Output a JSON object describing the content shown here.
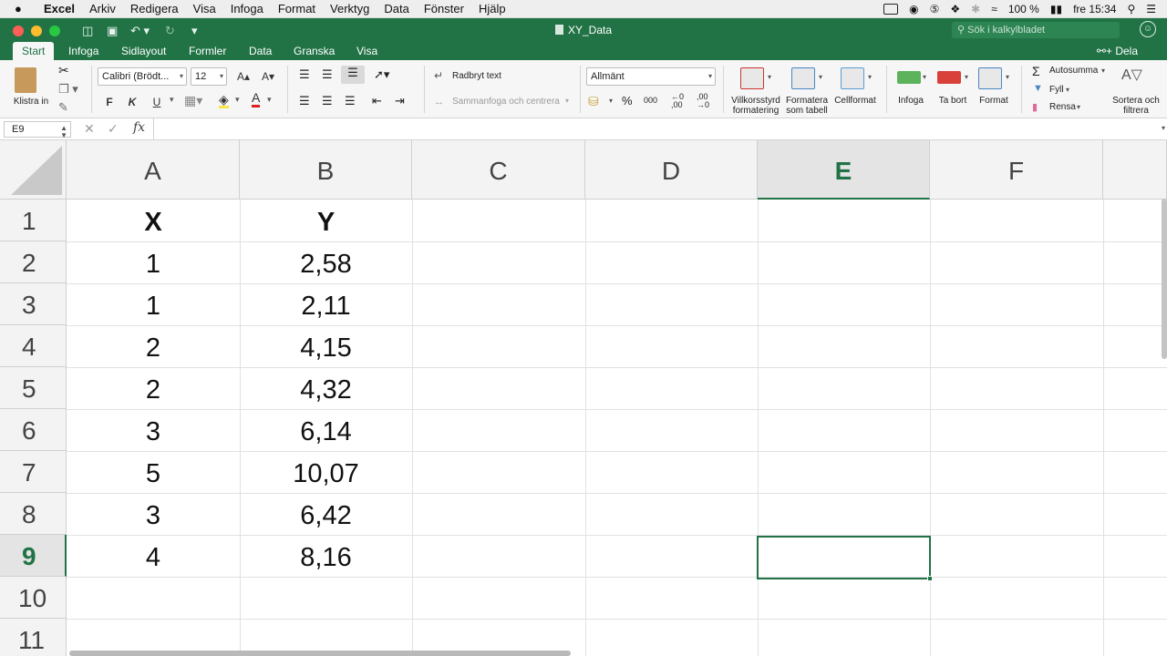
{
  "menubar": {
    "app_name": "Excel",
    "items": [
      "Arkiv",
      "Redigera",
      "Visa",
      "Infoga",
      "Format",
      "Verktyg",
      "Data",
      "Fönster",
      "Hjälp"
    ],
    "battery": "100 %",
    "clock": "fre 15:34"
  },
  "window": {
    "title": "XY_Data",
    "search_placeholder": "Sök i kalkylbladet",
    "share_label": "Dela"
  },
  "tabs": [
    "Start",
    "Infoga",
    "Sidlayout",
    "Formler",
    "Data",
    "Granska",
    "Visa"
  ],
  "active_tab": "Start",
  "ribbon": {
    "paste_label": "Klistra in",
    "font_name": "Calibri (Brödt...",
    "font_size": "12",
    "grow_font": "A▴",
    "shrink_font": "A▾",
    "bold": "F",
    "italic": "K",
    "underline": "U",
    "wrap_text": "Radbryt text",
    "merge_center": "Sammanfoga och centrera",
    "number_format": "Allmänt",
    "percent": "%",
    "thousands": "000",
    "conditional_formatting": "Villkorsstyrd formatering",
    "format_as_table": "Formatera som tabell",
    "cell_styles": "Cellformat",
    "insert": "Infoga",
    "delete": "Ta bort",
    "format": "Format",
    "autosum": "Autosumma",
    "fill": "Fyll",
    "clear": "Rensa",
    "sort_filter": "Sortera och filtrera"
  },
  "formula_bar": {
    "name_box": "E9",
    "cancel": "✕",
    "confirm": "✓",
    "fx": "fx",
    "content": ""
  },
  "sheet": {
    "columns": [
      "A",
      "B",
      "C",
      "D",
      "E",
      "F"
    ],
    "rows": [
      "1",
      "2",
      "3",
      "4",
      "5",
      "6",
      "7",
      "8",
      "9",
      "10",
      "11"
    ],
    "selected_column": "E",
    "selected_row": "9",
    "cells": [
      [
        "X",
        "Y"
      ],
      [
        "1",
        "2,58"
      ],
      [
        "1",
        "2,11"
      ],
      [
        "2",
        "4,15"
      ],
      [
        "2",
        "4,32"
      ],
      [
        "3",
        "6,14"
      ],
      [
        "5",
        "10,07"
      ],
      [
        "3",
        "6,42"
      ],
      [
        "4",
        "8,16"
      ]
    ]
  },
  "colors": {
    "accent": "#217346",
    "header_bg": "#f3f3f3",
    "gridline": "#e1e1e1"
  }
}
